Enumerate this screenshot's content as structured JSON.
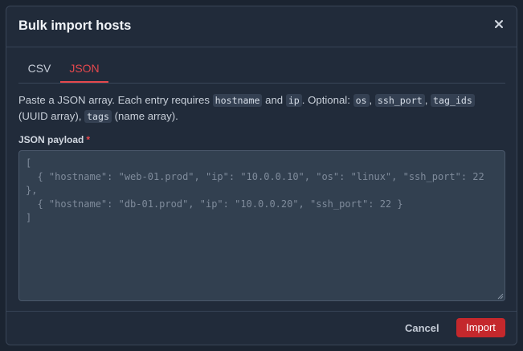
{
  "dialog": {
    "title": "Bulk import hosts",
    "close_icon": "close-icon"
  },
  "tabs": [
    {
      "label": "CSV",
      "active": false
    },
    {
      "label": "JSON",
      "active": true
    }
  ],
  "description": {
    "p1": "Paste a JSON array. Each entry requires ",
    "c1": "hostname",
    "p2": " and ",
    "c2": "ip",
    "p3": ". Optional: ",
    "c3": "os",
    "p4": ", ",
    "c4": "ssh_port",
    "p5": ", ",
    "c5": "tag_ids",
    "p6": " (UUID array), ",
    "c6": "tags",
    "p7": " (name array)."
  },
  "field": {
    "label": "JSON payload",
    "required_mark": "*",
    "value": "",
    "placeholder": "[\n  { \"hostname\": \"web-01.prod\", \"ip\": \"10.0.0.10\", \"os\": \"linux\", \"ssh_port\": 22 },\n  { \"hostname\": \"db-01.prod\", \"ip\": \"10.0.0.20\", \"ssh_port\": 22 }\n]"
  },
  "footer": {
    "cancel_label": "Cancel",
    "import_label": "Import"
  },
  "colors": {
    "accent": "#e5484d",
    "primary_button": "#c4282c",
    "panel": "#212b3a",
    "backdrop": "#1b2431"
  }
}
